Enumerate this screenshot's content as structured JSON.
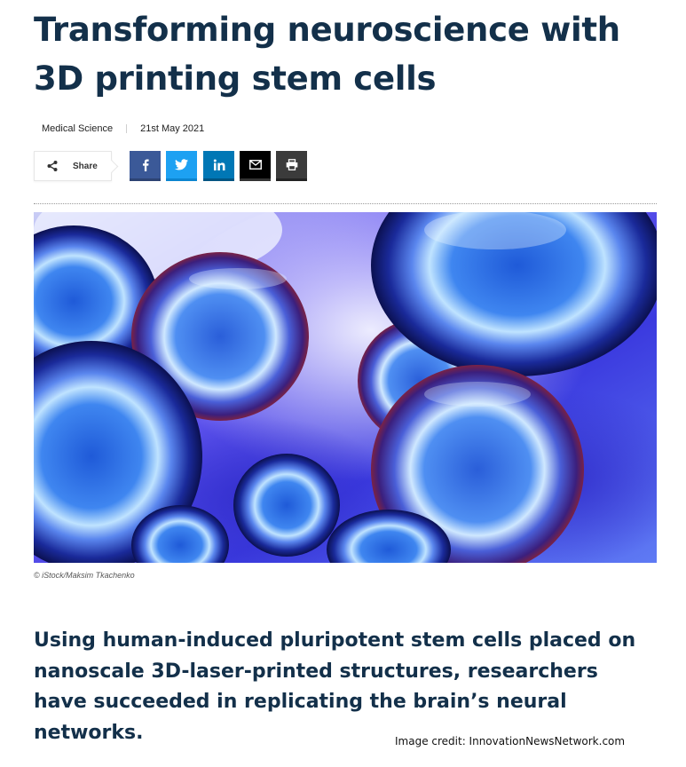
{
  "article": {
    "title": "Transforming neuroscience with 3D printing stem cells",
    "category": "Medical Science",
    "date": "21st May 2021",
    "lead": "Using human-induced pluripotent stem cells placed on nanoscale 3D-laser-printed structures, researchers have succeeded in replicating the brain’s neural networks."
  },
  "share": {
    "label": "Share",
    "buttons": [
      {
        "name": "facebook",
        "icon": "facebook-icon",
        "color": "#3b5998"
      },
      {
        "name": "twitter",
        "icon": "twitter-icon",
        "color": "#1da1f2"
      },
      {
        "name": "linkedin",
        "icon": "linkedin-icon",
        "color": "#0077b5"
      },
      {
        "name": "email",
        "icon": "envelope-icon",
        "color": "#000000"
      },
      {
        "name": "print",
        "icon": "printer-icon",
        "color": "#3b3b3b"
      }
    ]
  },
  "image": {
    "caption": "© iStock/Maksim Tkachenko"
  },
  "credit": "Image credit: InnovationNewsNetwork.com"
}
